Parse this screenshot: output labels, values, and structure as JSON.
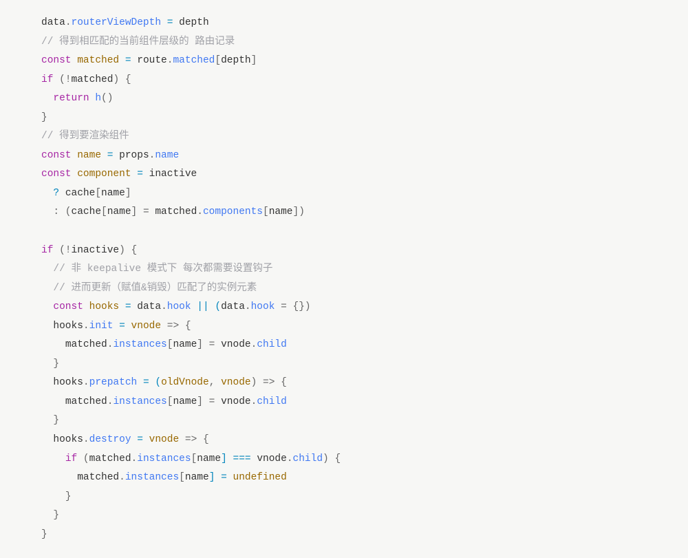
{
  "code": {
    "t1": "data",
    "t2": ".",
    "t3": "routerViewDepth",
    "t4": " = ",
    "t5": "depth",
    "c1": "// 得到相匹配的当前组件层级的 路由记录",
    "k1": "const",
    "t6": " matched ",
    "t7": "=",
    "t8": " route",
    "t9": ".",
    "t10": "matched",
    "t11": "[",
    "t12": "depth",
    "t13": "]",
    "k2": "if",
    "t14": " (!",
    "t15": "matched",
    "t16": ") {",
    "k3": "return",
    "t17": " ",
    "t18": "h",
    "t19": "()",
    "t20": "}",
    "c2": "// 得到要渲染组件",
    "k4": "const",
    "t21": " name ",
    "t22": "=",
    "t23": " props",
    "t24": ".",
    "t25": "name",
    "k5": "const",
    "t26": " component ",
    "t27": "=",
    "t28": " inactive",
    "t29": "? ",
    "t30": "cache",
    "t31": "[",
    "t32": "name",
    "t33": "]",
    "t34": ": (",
    "t35": "cache",
    "t36": "[",
    "t37": "name",
    "t38": "] = ",
    "t39": "matched",
    "t40": ".",
    "t41": "components",
    "t42": "[",
    "t43": "name",
    "t44": "])",
    "k6": "if",
    "t45": " (!",
    "t46": "inactive",
    "t47": ") {",
    "c3": "// 非 keepalive 模式下 每次都需要设置钩子",
    "c4": "// 进而更新（赋值&销毁）匹配了的实例元素",
    "k7": "const",
    "t48": " hooks ",
    "t49": "=",
    "t50": " data",
    "t51": ".",
    "t52": "hook",
    "t53": " || (",
    "t54": "data",
    "t55": ".",
    "t56": "hook",
    "t57": " = {})",
    "t58": "hooks",
    "t59": ".",
    "t60": "init",
    "t61": " = ",
    "t62": "vnode",
    "t63": " => {",
    "t64": "matched",
    "t65": ".",
    "t66": "instances",
    "t67": "[",
    "t68": "name",
    "t69": "] = ",
    "t70": "vnode",
    "t71": ".",
    "t72": "child",
    "t73": "}",
    "t74": "hooks",
    "t75": ".",
    "t76": "prepatch",
    "t77": " = (",
    "t78": "oldVnode",
    "t79": ", ",
    "t80": "vnode",
    "t81": ") => {",
    "t82": "matched",
    "t83": ".",
    "t84": "instances",
    "t85": "[",
    "t86": "name",
    "t87": "] = ",
    "t88": "vnode",
    "t89": ".",
    "t90": "child",
    "t91": "}",
    "t92": "hooks",
    "t93": ".",
    "t94": "destroy",
    "t95": " = ",
    "t96": "vnode",
    "t97": " => {",
    "k8": "if",
    "t98": " (",
    "t99": "matched",
    "t100": ".",
    "t101": "instances",
    "t102": "[",
    "t103": "name",
    "t104": "] === ",
    "t105": "vnode",
    "t106": ".",
    "t107": "child",
    "t108": ") {",
    "t109": "matched",
    "t110": ".",
    "t111": "instances",
    "t112": "[",
    "t113": "name",
    "t114": "] = ",
    "t115": "undefined",
    "t116": "}",
    "t117": "}",
    "t118": "}"
  }
}
